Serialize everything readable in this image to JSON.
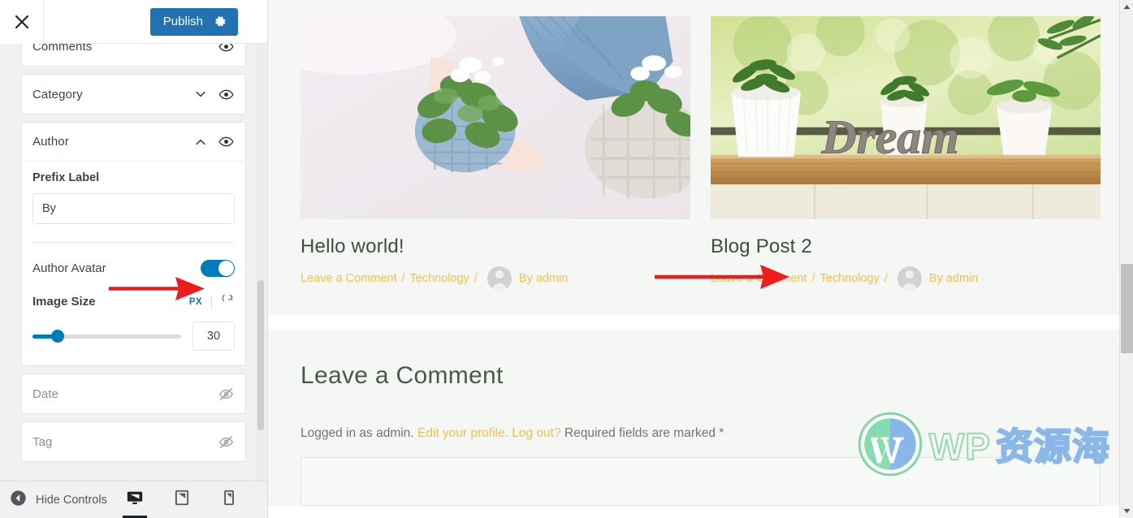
{
  "app": {
    "name": "WordPress Customizer",
    "accent_blue": "#2271b1",
    "toggle_blue": "#007cba",
    "meta_yellow": "#f3c04e",
    "annotation_red": "#ee1c1c"
  },
  "sidebar": {
    "close_label": "Close",
    "close_icon": "close-icon",
    "publish": {
      "label": "Publish",
      "gear_icon": "gear-icon"
    },
    "panels": [
      {
        "title": "Comments",
        "visibility_icon": "eye-visible-icon",
        "state": "collapsed",
        "hidden": false
      },
      {
        "title": "Category",
        "chevron_icon": "chevron-down-icon",
        "visibility_icon": "eye-visible-icon",
        "state": "collapsed",
        "hidden": false
      },
      {
        "title": "Author",
        "chevron_icon": "chevron-up-icon",
        "visibility_icon": "eye-visible-icon",
        "state": "expanded",
        "hidden": false
      },
      {
        "title": "Date",
        "visibility_icon": "eye-hidden-icon",
        "state": "collapsed",
        "hidden": true
      },
      {
        "title": "Tag",
        "visibility_icon": "eye-hidden-icon",
        "state": "collapsed",
        "hidden": true
      }
    ],
    "author_panel": {
      "prefix_label_title": "Prefix Label",
      "prefix_label_value": "By",
      "prefix_label_placeholder": "By",
      "author_avatar_label": "Author Avatar",
      "author_avatar_enabled": "on",
      "image_size_label": "Image Size",
      "unit_label": "PX",
      "reset_icon": "reset-icon",
      "image_size_value": "30",
      "slider_percent": 17
    },
    "footer": {
      "hide_controls_label": "Hide Controls",
      "back_icon": "chevron-left-circle-icon",
      "devices": [
        {
          "name": "desktop",
          "icon": "desktop-icon",
          "active": true
        },
        {
          "name": "tablet",
          "icon": "tablet-icon",
          "active": false
        },
        {
          "name": "mobile",
          "icon": "mobile-icon",
          "active": false
        }
      ]
    }
  },
  "preview": {
    "posts": [
      {
        "title": "Hello world!",
        "image_alt": "hands-planting-violet-in-knit-pot",
        "comment_link": "Leave a Comment",
        "sep1": "/",
        "category": "Technology",
        "sep2": "/",
        "avatar_icon": "author-avatar-placeholder",
        "author": "By admin"
      },
      {
        "title": "Blog Post 2",
        "image_alt": "succulents-on-wooden-shelf-with-dream-sign",
        "comment_link": "Leave a Comment",
        "sep1": "/",
        "category": "Technology",
        "sep2": "/",
        "avatar_icon": "author-avatar-placeholder",
        "author": "By admin"
      }
    ],
    "comments_section": {
      "title": "Leave a Comment",
      "logged_in_prefix": "Logged in as admin.",
      "edit_profile_link": "Edit your profile.",
      "logout_link": "Log out?",
      "required_note": "Required fields are marked *"
    }
  },
  "annotations": [
    {
      "name": "arrow-to-author-avatar-toggle",
      "color": "#ee1c1c"
    },
    {
      "name": "arrow-to-preview-avatar",
      "color": "#ee1c1c"
    }
  ],
  "watermark": {
    "logo_icon": "wordpress-logo-icon",
    "text_en": "WP",
    "text_cn": "资源海"
  },
  "scrollbars": {
    "sidebar_thumb": "sidebar-scroll-thumb",
    "browser_up_icon": "scroll-up-arrow-icon",
    "browser_down_icon": "scroll-down-arrow-icon",
    "browser_thumb": "browser-scroll-thumb"
  }
}
